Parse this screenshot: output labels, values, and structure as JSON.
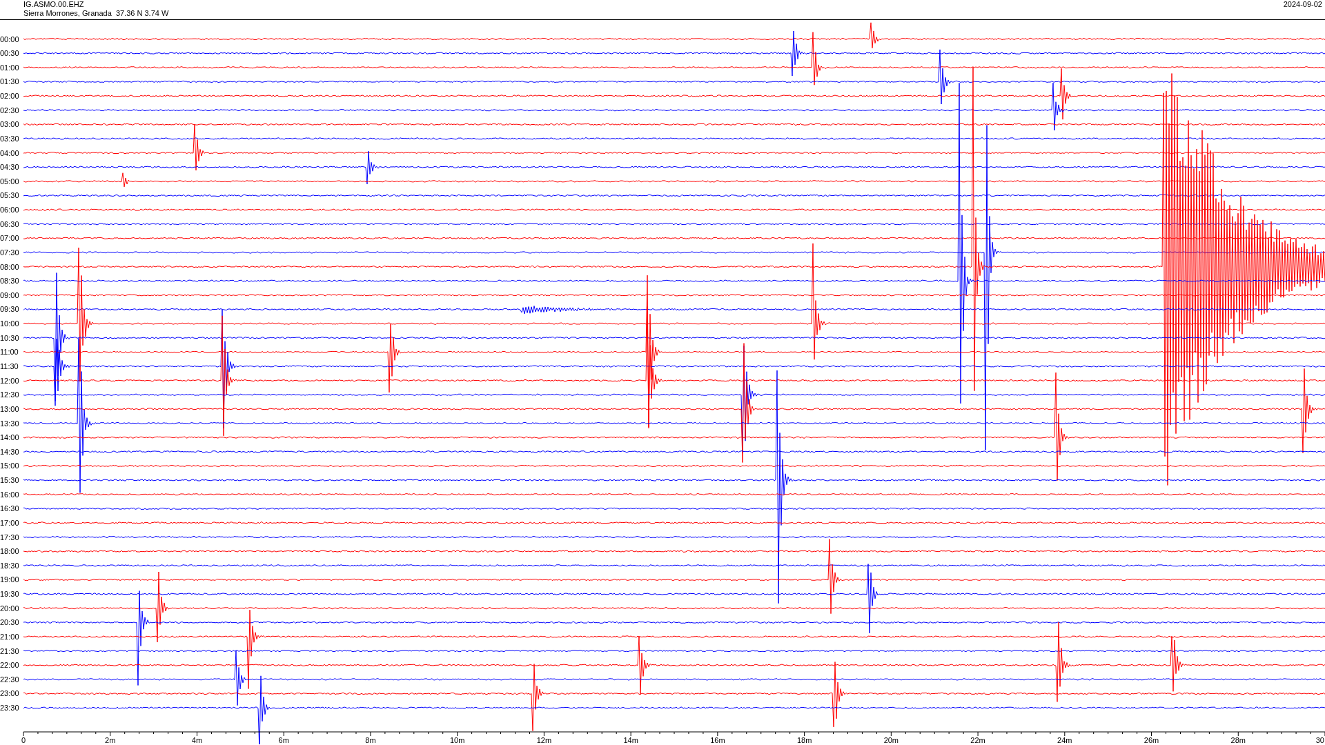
{
  "header": {
    "station": "IG.ASMO.00.EHZ",
    "location": "Sierra Morrones, Granada  37.36 N 3.74 W",
    "date": "2024-09-02"
  },
  "rows": [
    {
      "label": "00:00"
    },
    {
      "label": "00:30"
    },
    {
      "label": "01:00"
    },
    {
      "label": "01:30"
    },
    {
      "label": "02:00"
    },
    {
      "label": "02:30"
    },
    {
      "label": "03:00"
    },
    {
      "label": "03:30"
    },
    {
      "label": "04:00"
    },
    {
      "label": "04:30"
    },
    {
      "label": "05:00"
    },
    {
      "label": "05:30"
    },
    {
      "label": "06:00"
    },
    {
      "label": "06:30"
    },
    {
      "label": "07:00"
    },
    {
      "label": "07:30"
    },
    {
      "label": "08:00"
    },
    {
      "label": "08:30"
    },
    {
      "label": "09:00"
    },
    {
      "label": "09:30"
    },
    {
      "label": "10:00"
    },
    {
      "label": "10:30"
    },
    {
      "label": "11:00"
    },
    {
      "label": "11:30"
    },
    {
      "label": "12:00"
    },
    {
      "label": "12:30"
    },
    {
      "label": "13:00"
    },
    {
      "label": "13:30"
    },
    {
      "label": "14:00"
    },
    {
      "label": "14:30"
    },
    {
      "label": "15:00"
    },
    {
      "label": "15:30"
    },
    {
      "label": "16:00"
    },
    {
      "label": "16:30"
    },
    {
      "label": "17:00"
    },
    {
      "label": "17:30"
    },
    {
      "label": "18:00"
    },
    {
      "label": "18:30"
    },
    {
      "label": "19:00"
    },
    {
      "label": "19:30"
    },
    {
      "label": "20:00"
    },
    {
      "label": "20:30"
    },
    {
      "label": "21:00"
    },
    {
      "label": "21:30"
    },
    {
      "label": "22:00"
    },
    {
      "label": "22:30"
    },
    {
      "label": "23:00"
    },
    {
      "label": "23:30"
    }
  ],
  "x_axis": {
    "tick_labels": [
      "0",
      "2m",
      "4m",
      "6m",
      "8m",
      "10m",
      "12m",
      "14m",
      "16m",
      "18m",
      "20m",
      "22m",
      "24m",
      "26m",
      "28m",
      "30"
    ]
  }
}
